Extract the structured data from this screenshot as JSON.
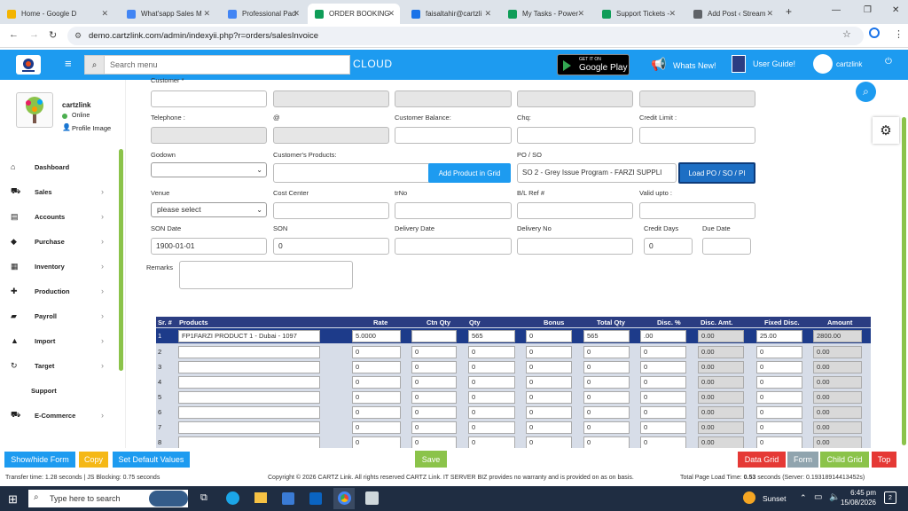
{
  "browser": {
    "tabs": [
      {
        "label": "Home - Google D",
        "color": "#f4b400"
      },
      {
        "label": "What'sapp Sales M",
        "color": "#4285f4"
      },
      {
        "label": "Professional Packa",
        "color": "#4285f4"
      },
      {
        "label": "ORDER BOOKING",
        "color": "#0f9d58",
        "active": true
      },
      {
        "label": "faisaltahir@cartzli",
        "color": "#1a73e8"
      },
      {
        "label": "My Tasks - Power",
        "color": "#0f9d58"
      },
      {
        "label": "Support Tickets -",
        "color": "#0f9d58"
      },
      {
        "label": "Add Post ‹ Stream",
        "color": "#5f6368"
      }
    ],
    "new_tab": "+",
    "url": "demo.cartzlink.com/admin/indexyii.php?r=orders/salesInvoice"
  },
  "header": {
    "search_placeholder": "Search menu",
    "cloud": "CLOUD",
    "google_play_small": "GET IT ON",
    "google_play": "Google Play",
    "whats_new": "Whats New!",
    "user_guide": "User Guide!",
    "username": "cartzlink"
  },
  "sidebar": {
    "name": "cartzlink",
    "status": "Online",
    "profile_image": "Profile Image",
    "items": [
      {
        "label": "Dashboard",
        "icon": "home-icon",
        "glyph": "⌂",
        "arrow": false
      },
      {
        "label": "Sales",
        "icon": "cart-icon",
        "glyph": "⛟",
        "arrow": true
      },
      {
        "label": "Accounts",
        "icon": "bank-icon",
        "glyph": "▤",
        "arrow": true
      },
      {
        "label": "Purchase",
        "icon": "tag-icon",
        "glyph": "◆",
        "arrow": true
      },
      {
        "label": "Inventory",
        "icon": "grid-icon",
        "glyph": "▦",
        "arrow": true
      },
      {
        "label": "Production",
        "icon": "production-icon",
        "glyph": "✚",
        "arrow": true
      },
      {
        "label": "Payroll",
        "icon": "money-icon",
        "glyph": "▰",
        "arrow": true
      },
      {
        "label": "Import",
        "icon": "import-icon",
        "glyph": "▲",
        "arrow": true
      },
      {
        "label": "Target",
        "icon": "refresh-icon",
        "glyph": "↻",
        "arrow": true
      },
      {
        "label": "Support",
        "icon": "",
        "glyph": "",
        "arrow": false
      },
      {
        "label": "E-Commerce",
        "icon": "cart-icon",
        "glyph": "⛟",
        "arrow": true
      }
    ]
  },
  "form": {
    "customer_label": "Customer *",
    "telephone_label": "Telephone :",
    "at_label": "@",
    "customer_balance_label": "Customer Balance:",
    "chq_label": "Chq:",
    "credit_limit_label": "Credit Limit :",
    "godown_label": "Godown",
    "customers_products_label": "Customer's Products:",
    "add_product_button": "Add Product in Grid",
    "po_so_label": "PO / SO",
    "po_so_value": "SO 2 - Grey Issue Program - FARZI SUPPLI",
    "load_po_button": "Load PO / SO / PI",
    "venue_label": "Venue",
    "venue_value": "please select",
    "cost_center_label": "Cost Center",
    "trno_label": "trNo",
    "bl_ref_label": "B/L Ref #",
    "valid_upto_label": "Valid upto :",
    "son_date_label": "SON Date",
    "son_date_value": "1900-01-01",
    "son_label": "SON",
    "son_value": "0",
    "delivery_date_label": "Delivery Date",
    "delivery_no_label": "Delivery No",
    "credit_days_label": "Credit Days",
    "credit_days_value": "0",
    "due_date_label": "Due Date",
    "remarks_label": "Remarks"
  },
  "grid": {
    "headers": [
      "Sr. #",
      "Products",
      "Rate",
      "Ctn Qty",
      "Qty",
      "Bonus",
      "Total Qty",
      "Disc. %",
      "Disc. Amt.",
      "Fixed Disc.",
      "Amount"
    ],
    "first_row": {
      "sr": "1",
      "product": "FP1FARZI PRODUCT 1 - Dubai - 1097",
      "rate": "5.0000",
      "ctn": "",
      "qty": "565",
      "bonus": "0",
      "total": "565",
      "disc_pct": ".00",
      "disc_amt": "0.00",
      "fixed": "25.00",
      "amount": "2800.00"
    },
    "empty_rows": [
      {
        "sr": "2",
        "zero": "0",
        "dec": "0.00"
      },
      {
        "sr": "3",
        "zero": "0",
        "dec": "0.00"
      },
      {
        "sr": "4",
        "zero": "0",
        "dec": "0.00"
      },
      {
        "sr": "5",
        "zero": "0",
        "dec": "0.00"
      },
      {
        "sr": "6",
        "zero": "0",
        "dec": "0.00"
      },
      {
        "sr": "7",
        "zero": "0",
        "dec": "0.00"
      },
      {
        "sr": "8",
        "zero": "0",
        "dec": "0.00"
      }
    ]
  },
  "bottom": {
    "show_hide": "Show/hide Form",
    "copy": "Copy",
    "set_default": "Set Default Values",
    "save": "Save",
    "data_grid": "Data Grid",
    "form": "Form",
    "child_grid": "Child Grid",
    "top": "Top"
  },
  "status": {
    "left": "Transfer time: 1.28 seconds | JS Blocking: 0.75 seconds",
    "center": "Copyright © 2026 CARTZ Link. All rights reserved CARTZ Link. IT SERVER BIZ provides no warranty and is provided on as on basis.",
    "right_prefix": "Total Page Load Time:",
    "right_value": "0.53",
    "right_suffix": "seconds (Server: 0.19318914413452s)"
  },
  "taskbar": {
    "search": "Type here to search",
    "weather": "Sunset",
    "time": "6:45 pm",
    "date": "15/08/2026",
    "notif": "2"
  }
}
